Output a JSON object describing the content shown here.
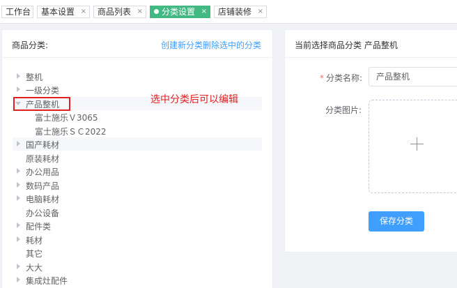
{
  "tabs": [
    {
      "label": "工作台",
      "active": false,
      "closable": false
    },
    {
      "label": "基本设置",
      "active": false,
      "closable": true
    },
    {
      "label": "商品列表",
      "active": false,
      "closable": true
    },
    {
      "label": "分类设置",
      "active": true,
      "closable": true
    },
    {
      "label": "店铺装修",
      "active": false,
      "closable": true
    }
  ],
  "tab_close_glyph": "×",
  "left_panel": {
    "title": "商品分类:",
    "create_link": "创建新分类",
    "delete_link": "删除选中的分类"
  },
  "tree": [
    {
      "label": "整机",
      "level": 0,
      "arrow": "right",
      "highlighted": false
    },
    {
      "label": "一级分类",
      "level": 0,
      "arrow": "right",
      "highlighted": false
    },
    {
      "label": "产品整机",
      "level": 0,
      "arrow": "down",
      "highlighted": true
    },
    {
      "label": "富士施乐Ｖ3065",
      "level": 1,
      "arrow": "none",
      "highlighted": false
    },
    {
      "label": "富士施乐ＳＣ2022",
      "level": 1,
      "arrow": "none",
      "highlighted": false
    },
    {
      "label": "国产耗材",
      "level": 0,
      "arrow": "right",
      "highlighted": true
    },
    {
      "label": "原装耗材",
      "level": 0,
      "arrow": "none",
      "highlighted": false
    },
    {
      "label": "办公用品",
      "level": 0,
      "arrow": "right",
      "highlighted": false
    },
    {
      "label": "数码产品",
      "level": 0,
      "arrow": "right",
      "highlighted": false
    },
    {
      "label": "电脑耗材",
      "level": 0,
      "arrow": "right",
      "highlighted": false
    },
    {
      "label": "办公设备",
      "level": 0,
      "arrow": "none",
      "highlighted": false
    },
    {
      "label": "配件类",
      "level": 0,
      "arrow": "right",
      "highlighted": false
    },
    {
      "label": "耗材",
      "level": 0,
      "arrow": "right",
      "highlighted": false
    },
    {
      "label": "其它",
      "level": 0,
      "arrow": "none",
      "highlighted": false
    },
    {
      "label": "大大",
      "level": 0,
      "arrow": "right",
      "highlighted": false
    },
    {
      "label": "集成灶配件",
      "level": 0,
      "arrow": "right",
      "highlighted": false
    }
  ],
  "annotation": "选中分类后可以编辑",
  "right_panel": {
    "title": "当前选择商品分类 产品整机",
    "name_label": "分类名称:",
    "name_required_mark": "*",
    "name_value": "产品整机",
    "image_label": "分类图片:",
    "upload_icon": "plus-icon",
    "save_button": "保存分类"
  },
  "colors": {
    "active_tab": "#42b983",
    "link": "#409eff",
    "primary_button": "#409eff",
    "annotation": "#e02020"
  }
}
